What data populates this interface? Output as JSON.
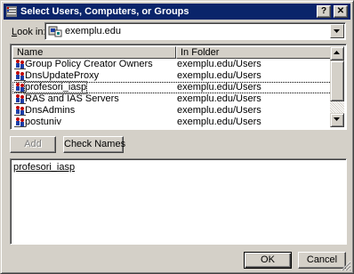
{
  "window": {
    "title": "Select Users, Computers, or Groups",
    "help_glyph": "?",
    "close_glyph": "✕"
  },
  "lookin": {
    "label_accel": "L",
    "label_rest": "ook in:",
    "value": "exemplu.edu"
  },
  "list": {
    "columns": [
      "Name",
      "In Folder"
    ],
    "rows": [
      {
        "name": "Group Policy Creator Owners",
        "folder": "exemplu.edu/Users"
      },
      {
        "name": "DnsUpdateProxy",
        "folder": "exemplu.edu/Users"
      },
      {
        "name": "profesori_iasp",
        "folder": "exemplu.edu/Users"
      },
      {
        "name": "RAS and IAS Servers",
        "folder": "exemplu.edu/Users"
      },
      {
        "name": "DnsAdmins",
        "folder": "exemplu.edu/Users"
      },
      {
        "name": "postuniv",
        "folder": "exemplu.edu/Users"
      }
    ],
    "focused_index": 2
  },
  "buttons": {
    "add": "Add",
    "check_names": "Check Names",
    "ok": "OK",
    "cancel": "Cancel"
  },
  "selection_text": "profesori_iasp",
  "colors": {
    "titlebar": "#0a246a",
    "face": "#d4d0c8",
    "group_icon_red": "#c00000",
    "group_icon_blue": "#1c3fa8"
  }
}
